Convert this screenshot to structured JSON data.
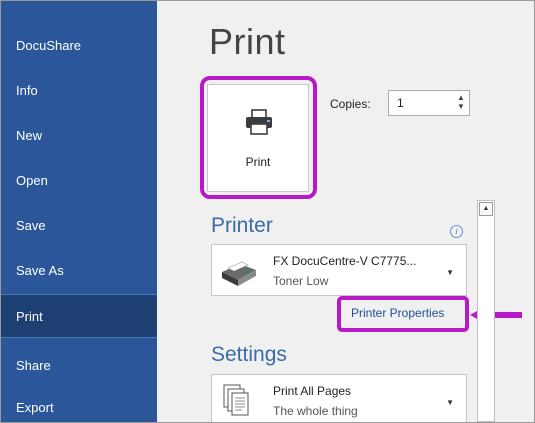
{
  "sidebar": {
    "items": [
      {
        "label": "DocuShare"
      },
      {
        "label": "Info"
      },
      {
        "label": "New"
      },
      {
        "label": "Open"
      },
      {
        "label": "Save"
      },
      {
        "label": "Save As"
      },
      {
        "label": "Print",
        "active": true
      },
      {
        "label": "Share"
      },
      {
        "label": "Export"
      }
    ]
  },
  "main": {
    "title": "Print",
    "print_button_label": "Print",
    "copies": {
      "label": "Copies:",
      "value": "1"
    },
    "printer_section": {
      "heading": "Printer",
      "selected_name": "FX DocuCentre-V C7775...",
      "status": "Toner Low",
      "properties_link": "Printer Properties"
    },
    "settings_section": {
      "heading": "Settings",
      "pages_option": "Print All Pages",
      "pages_description": "The whole thing"
    }
  },
  "colors": {
    "sidebar_bg": "#2b579a",
    "sidebar_active_bg": "#1e3f72",
    "highlight": "#b619c8",
    "heading": "#3a6ba9",
    "link": "#1f4e96"
  },
  "icons": [
    "printer-icon",
    "info-icon",
    "printer-device-icon",
    "pages-icon",
    "arrow-left-icon",
    "chevron-down-icon",
    "scroll-up-icon"
  ]
}
